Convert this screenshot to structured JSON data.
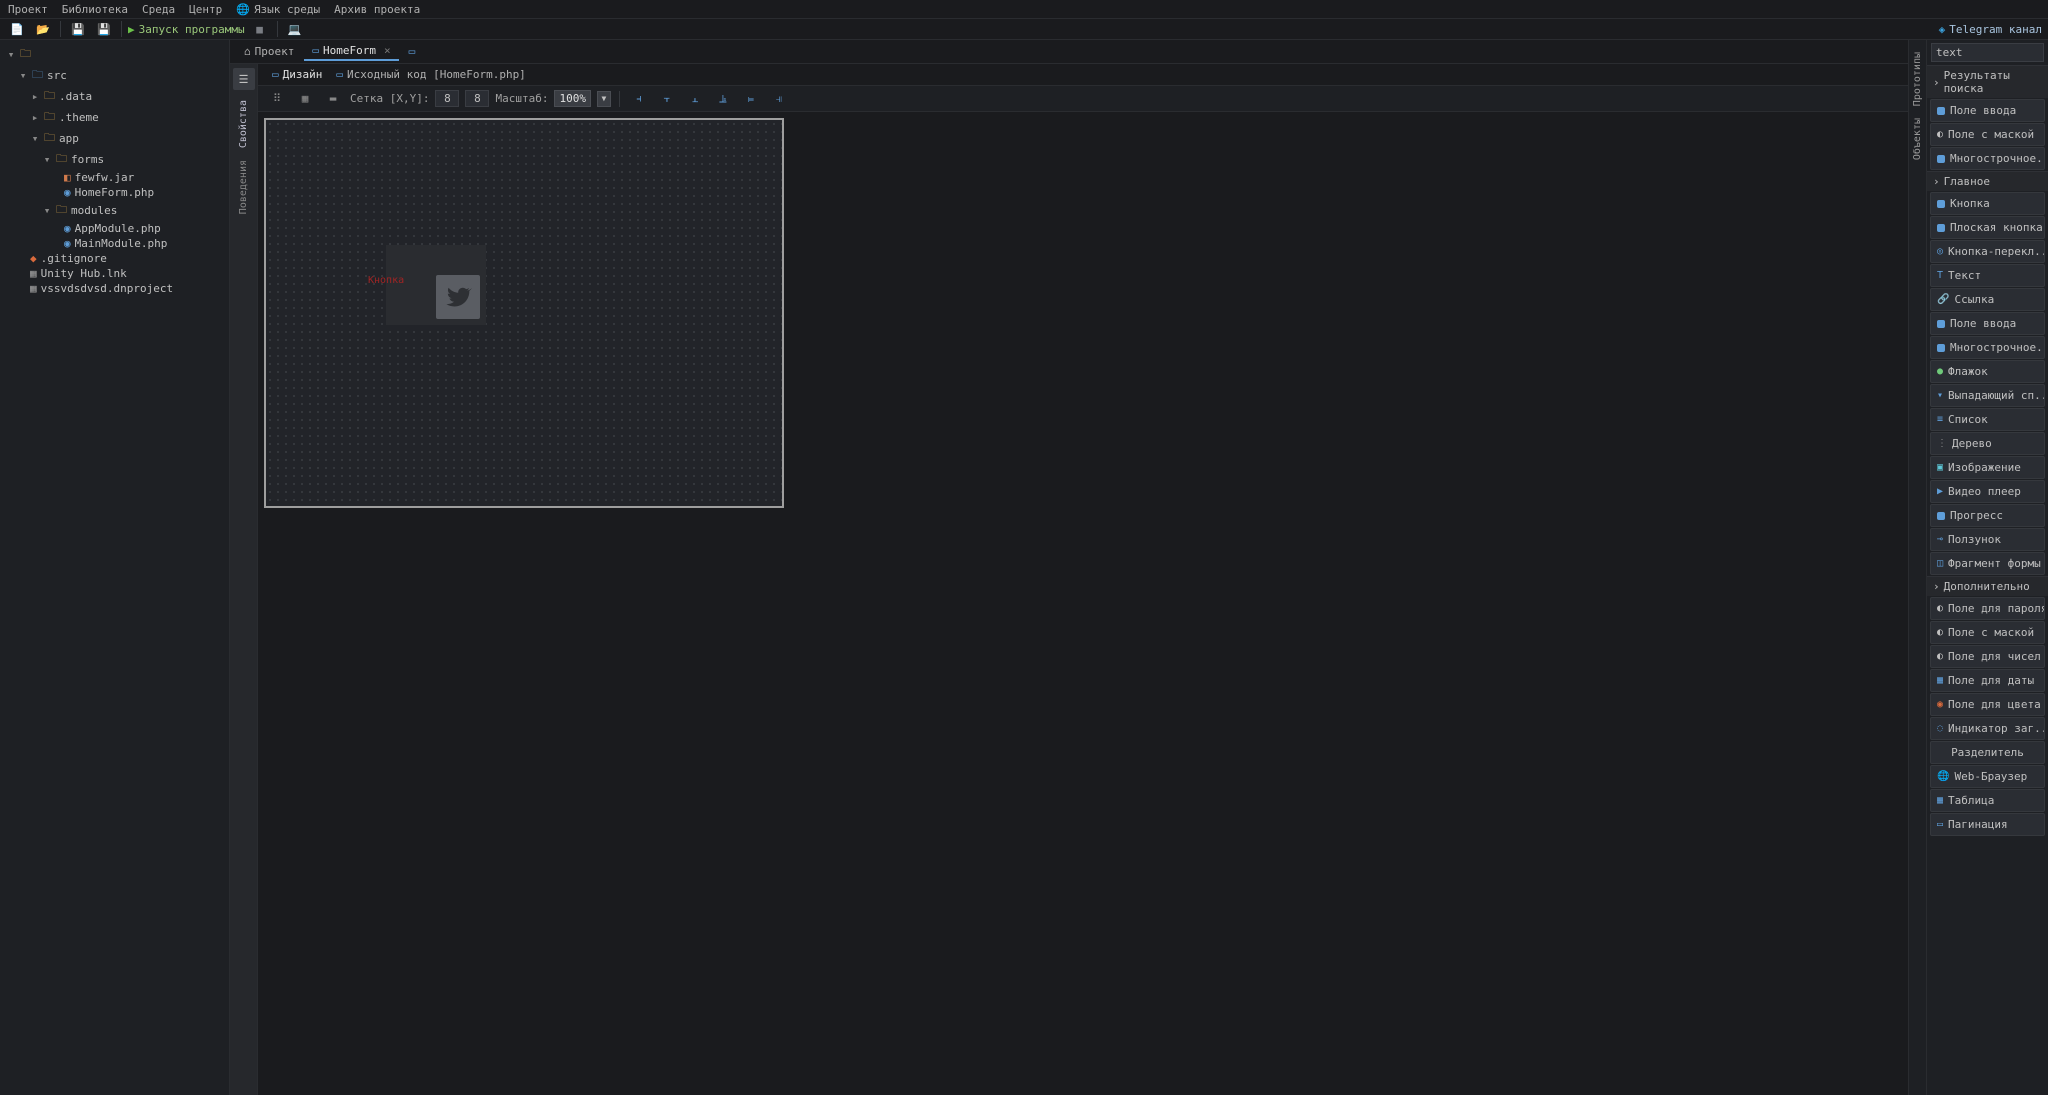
{
  "menu": [
    "Проект",
    "Библиотека",
    "Среда",
    "Центр",
    "Язык среды",
    "Архив проекта"
  ],
  "run_label": "Запуск программы",
  "telegram": "Telegram канал",
  "tree": {
    "root": "",
    "src": "src",
    "data": ".data",
    "theme": ".theme",
    "app": "app",
    "forms": "forms",
    "fewfw": "fewfw.jar",
    "homeform": "HomeForm.php",
    "modules": "modules",
    "appmod": "AppModule.php",
    "mainmod": "MainModule.php",
    "gitignore": ".gitignore",
    "unityhub": "Unity Hub.lnk",
    "vssv": "vssvdsdvsd.dnproject"
  },
  "tabs": {
    "project": "Проект",
    "homeform": "HomeForm"
  },
  "side_tabs": {
    "props": "Свойства",
    "behavior": "Поведения"
  },
  "subtabs": {
    "design": "Дизайн",
    "source": "Исходный код [HomeForm.php]"
  },
  "design_tools": {
    "grid": "Сетка [X,Y]:",
    "gx": "8",
    "gy": "8",
    "scale": "Масштаб:",
    "zoom": "100%"
  },
  "canvas": {
    "button_label": "Кнопка"
  },
  "right_rail": {
    "proto": "Прототипы",
    "obj": "Объекты"
  },
  "search_value": "text",
  "groups": {
    "results": "Результаты поиска",
    "main": "Главное",
    "extra": "Дополнительно"
  },
  "proto": {
    "r1": "Поле ввода",
    "r2": "Поле с маской",
    "r3": "Многострочное...",
    "m1": "Кнопка",
    "m2": "Плоская кнопка",
    "m3": "Кнопка-перекл...",
    "m4": "Текст",
    "m5": "Ссылка",
    "m6": "Поле ввода",
    "m7": "Многострочное...",
    "m8": "Флажок",
    "m9": "Выпадающий сп...",
    "m10": "Список",
    "m11": "Дерево",
    "m12": "Изображение",
    "m13": "Видео плеер",
    "m14": "Прогресс",
    "m15": "Ползунок",
    "m16": "Фрагмент формы",
    "e1": "Поле для пароля",
    "e2": "Поле с маской",
    "e3": "Поле для чисел",
    "e4": "Поле для даты",
    "e5": "Поле для цвета",
    "e6": "Индикатор заг...",
    "e7": "Разделитель",
    "e8": "Web-Браузер",
    "e9": "Таблица",
    "e10": "Пагинация"
  }
}
